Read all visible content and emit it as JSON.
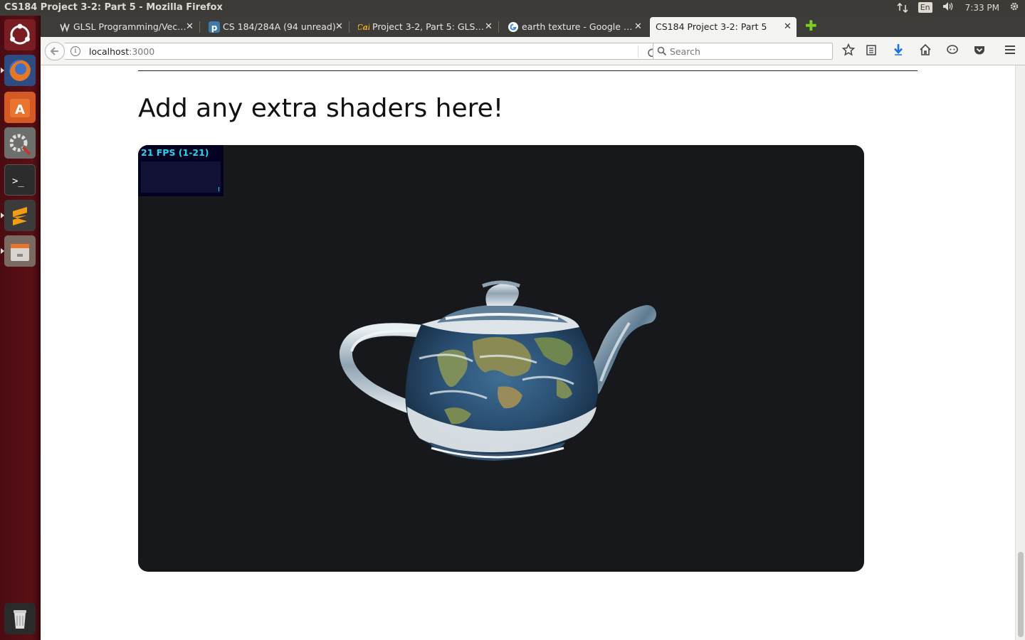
{
  "window": {
    "title": "CS184 Project 3-2: Part 5 - Mozilla Firefox"
  },
  "panel": {
    "language": "En",
    "time": "7:33 PM"
  },
  "launcher": {
    "items": [
      {
        "name": "ubuntu-dash"
      },
      {
        "name": "firefox"
      },
      {
        "name": "software-center"
      },
      {
        "name": "system-settings"
      },
      {
        "name": "terminal"
      },
      {
        "name": "sublime-text"
      },
      {
        "name": "file-manager"
      },
      {
        "name": "trash"
      }
    ]
  },
  "tabs": [
    {
      "label": "GLSL Programming/Vec…",
      "favicon": "wikibooks-icon"
    },
    {
      "label": "CS 184/284A (94 unread)",
      "favicon": "piazza-icon"
    },
    {
      "label": "Project 3-2, Part 5: GLS…",
      "favicon": "cal-icon"
    },
    {
      "label": "earth texture - Google …",
      "favicon": "google-icon"
    },
    {
      "label": "CS184 Project 3-2: Part 5",
      "favicon": "",
      "active": true
    }
  ],
  "nav": {
    "url_host": "localhost",
    "url_port": ":3000",
    "search_placeholder": "Search"
  },
  "page": {
    "heading": "Add any extra shaders here!",
    "fps_text": "21 FPS (1-21)"
  },
  "colors": {
    "canvas_bg": "#16181c",
    "fps_cyan": "#22d4ee",
    "launcher_bg": "#4a0c11"
  }
}
